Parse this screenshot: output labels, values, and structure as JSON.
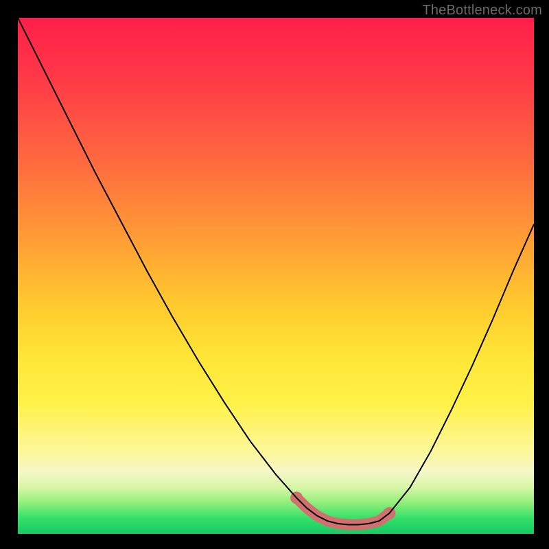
{
  "watermark": "TheBottleneck.com",
  "chart_data": {
    "type": "line",
    "title": "",
    "xlabel": "",
    "ylabel": "",
    "xlim": [
      0,
      100
    ],
    "ylim": [
      0,
      100
    ],
    "grid": false,
    "legend": false,
    "gradient_background": true,
    "series": [
      {
        "name": "bottleneck-curve",
        "color": "#000000",
        "x": [
          0,
          5,
          10,
          15,
          20,
          25,
          30,
          35,
          40,
          45,
          50,
          54,
          56,
          58,
          60,
          62,
          64,
          66,
          68,
          70,
          72,
          76,
          80,
          84,
          88,
          92,
          96,
          100
        ],
        "values": [
          100,
          90,
          80,
          70,
          60.5,
          51,
          42,
          33.5,
          25.5,
          18,
          11.5,
          7,
          5,
          3.5,
          2.5,
          2,
          1.8,
          1.8,
          2,
          2.5,
          4,
          9,
          16,
          24,
          32.5,
          41.5,
          51,
          60
        ]
      }
    ],
    "flat_segment": {
      "color": "#d26f6f",
      "x_start": 54,
      "x_end": 72,
      "y_approx": 2,
      "stroke_width_px": 16,
      "endpoint_dots": true
    }
  }
}
